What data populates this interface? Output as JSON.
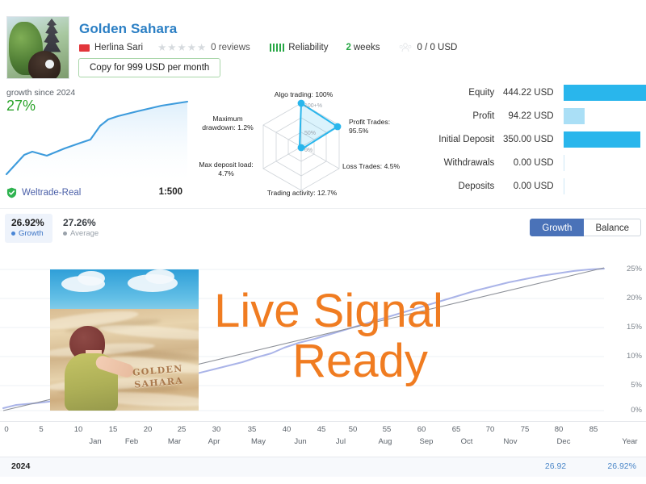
{
  "signal": {
    "name": "Golden Sahara",
    "author": "Herlina Sari",
    "flag_icon": "flag-icon",
    "avatar_icon": "avatar",
    "rating_stars": 5,
    "reviews": "0 reviews",
    "reliability_label": "Reliability",
    "reliability_bars": 5,
    "age_value": "2 weeks",
    "age_number": "2",
    "age_unit": "weeks",
    "subscribers": "0 / 0 USD",
    "copy_button": "Copy for 999 USD per month"
  },
  "growth_panel": {
    "caption": "growth since 2024",
    "percent": "27%",
    "broker": "Weltrade-Real",
    "leverage": "1:500",
    "verified_icon": "shield-check-icon"
  },
  "radar": {
    "title": "trading-quality-radar",
    "ring_labels": [
      "100+%",
      "50%",
      "0%"
    ],
    "axes": [
      {
        "key": "algo_trading",
        "label": "Algo trading: 100%",
        "value": 100
      },
      {
        "key": "profit_trades",
        "label": "Profit Trades:\n95.5%",
        "value": 95.5
      },
      {
        "key": "loss_trades",
        "label": "Loss Trades: 4.5%",
        "value": 4.5
      },
      {
        "key": "trading_activity",
        "label": "Trading activity: 12.7%",
        "value": 12.7
      },
      {
        "key": "max_deposit_load",
        "label": "Max deposit load:\n4.7%",
        "value": 4.7
      },
      {
        "key": "max_drawdown",
        "label": "Maximum\ndrawdown: 1.2%",
        "value": 1.2
      }
    ],
    "labels": {
      "algo": "Algo trading: 100%",
      "profit_l1": "Profit Trades:",
      "profit_l2": "95.5%",
      "loss": "Loss Trades: 4.5%",
      "activity": "Trading activity: 12.7%",
      "maxdep_l1": "Max deposit load:",
      "maxdep_l2": "4.7%",
      "maxdd_l1": "Maximum",
      "maxdd_l2": "drawdown: 1.2%"
    }
  },
  "stats": {
    "rows": [
      {
        "label": "Equity",
        "value": "444.22 USD",
        "bar_pct": 100,
        "color": "#29b6ec"
      },
      {
        "label": "Profit",
        "value": "94.22 USD",
        "bar_pct": 21,
        "color": "#aadff6"
      },
      {
        "label": "Initial Deposit",
        "value": "350.00 USD",
        "bar_pct": 79,
        "color": "#29b6ec"
      },
      {
        "label": "Withdrawals",
        "value": "0.00 USD",
        "bar_pct": 0,
        "color": "#29b6ec"
      },
      {
        "label": "Deposits",
        "value": "0.00 USD",
        "bar_pct": 0,
        "color": "#29b6ec"
      }
    ]
  },
  "metrics": [
    {
      "value": "26.92%",
      "name": "Growth",
      "dot": "blue"
    },
    {
      "value": "27.26%",
      "name": "Average",
      "dot": "gray"
    }
  ],
  "tabs": [
    {
      "label": "Growth",
      "active": true
    },
    {
      "label": "Balance",
      "active": false
    }
  ],
  "overlay": {
    "line1": "Live Signal",
    "line2": "Ready",
    "color": "#f07c21"
  },
  "illustration": {
    "name": "golden-sahara-artwork",
    "sand_text_line1": "GOLDEN",
    "sand_text_line2": "SAHARA"
  },
  "chart_data": {
    "type": "line",
    "title": "Growth",
    "xlabel": "",
    "ylabel": "",
    "ylim": [
      0,
      27
    ],
    "grid": true,
    "legend_position": "top-left",
    "y_ticks": [
      "0%",
      "5%",
      "10%",
      "15%",
      "20%",
      "25%"
    ],
    "y_tick_values": [
      0,
      5,
      10,
      15,
      20,
      25
    ],
    "x_ticks": [
      "0",
      "5",
      "10",
      "15",
      "20",
      "25",
      "30",
      "35",
      "40",
      "45",
      "50",
      "55",
      "60",
      "65",
      "70",
      "75",
      "80",
      "85"
    ],
    "x_tick_values": [
      0,
      5,
      10,
      15,
      20,
      25,
      30,
      35,
      40,
      45,
      50,
      55,
      60,
      65,
      70,
      75,
      80,
      85
    ],
    "x_month_labels": [
      "Jan",
      "Feb",
      "Mar",
      "Apr",
      "May",
      "Jun",
      "Jul",
      "Aug",
      "Sep",
      "Oct",
      "Nov",
      "Dec",
      "Year"
    ],
    "x_month_positions": [
      10,
      15,
      21,
      26,
      32,
      38,
      44,
      49,
      55,
      60,
      66,
      72,
      85
    ],
    "series": [
      {
        "name": "Growth",
        "color": "#aab4e8",
        "x": [
          0,
          2,
          4,
          6,
          8,
          10,
          12,
          14,
          16,
          18,
          20,
          22,
          24,
          26,
          28,
          30,
          32,
          34,
          36,
          38,
          40,
          42,
          44,
          46,
          48,
          50,
          52,
          54,
          56,
          58,
          60,
          62,
          64,
          66,
          68,
          70,
          72,
          74,
          76,
          78,
          80,
          82,
          84,
          86,
          88
        ],
        "values": [
          0.0,
          0.5,
          0.9,
          1.2,
          1.2,
          1.6,
          2.0,
          2.4,
          2.5,
          3.0,
          3.6,
          3.9,
          4.3,
          4.8,
          5.4,
          6.0,
          6.4,
          7.0,
          7.6,
          8.2,
          8.8,
          9.4,
          10.0,
          10.6,
          11.4,
          12.2,
          13.0,
          13.8,
          14.6,
          15.4,
          16.2,
          17.0,
          17.9,
          18.7,
          19.6,
          20.4,
          21.2,
          22.0,
          22.8,
          23.6,
          24.4,
          25.1,
          25.7,
          26.3,
          26.92
        ]
      },
      {
        "name": "Average",
        "color": "#8d9199",
        "x": [
          0,
          10,
          20,
          30,
          40,
          50,
          60,
          70,
          80,
          88
        ],
        "values": [
          0.6,
          3.3,
          6.2,
          9.0,
          12.0,
          15.0,
          18.0,
          21.0,
          24.2,
          26.6
        ]
      }
    ],
    "final_growth": "26.92%",
    "footer": {
      "year": "2024",
      "dec_value": "26.92",
      "year_total": "26.92%"
    }
  }
}
